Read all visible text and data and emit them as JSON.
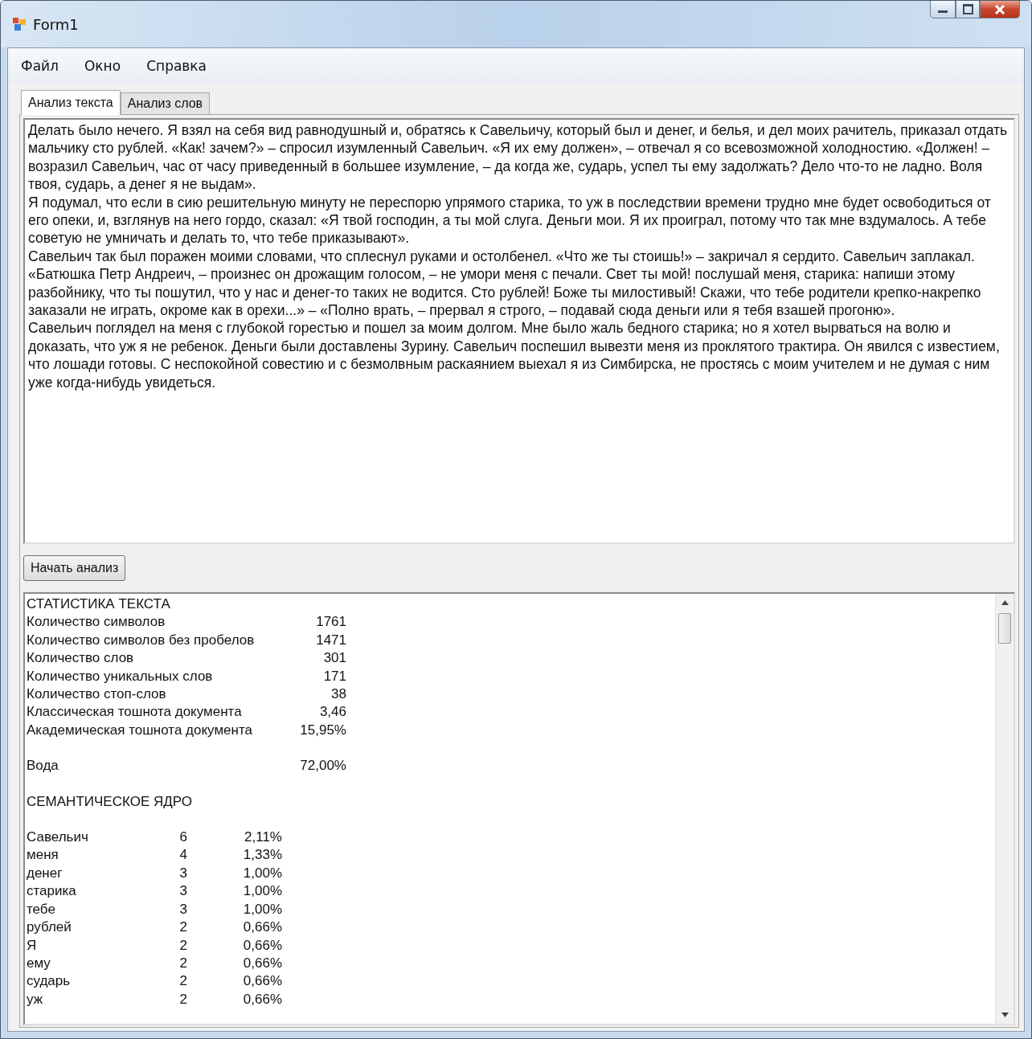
{
  "window": {
    "title": "Form1"
  },
  "menu": [
    "Файл",
    "Окно",
    "Справка"
  ],
  "tabs": [
    {
      "label": "Анализ текста",
      "selected": true
    },
    {
      "label": "Анализ слов",
      "selected": false
    }
  ],
  "text_input": {
    "paragraphs": [
      "Делать было нечего. Я взял на себя вид равнодушный и, обратясь к Савельичу, который был и денег, и белья, и дел моих рачитель, приказал отдать мальчику сто рублей. «Как! зачем?» – спросил изумленный Савельич. «Я их ему должен», – отвечал я со всевозможной холодностию. «Должен! – возразил Савельич, час от часу приведенный в большее изумление, – да когда же, сударь, успел ты ему задолжать? Дело что-то не ладно. Воля твоя, сударь, а денег я не выдам».",
      "Я подумал, что если в сию решительную минуту не переспорю упрямого старика, то уж в последствии времени трудно мне будет освободиться от его опеки, и, взглянув на него гордо, сказал: «Я твой господин, а ты мой слуга. Деньги мои. Я их проиграл, потому что так мне вздумалось. А тебе советую не умничать и делать то, что тебе приказывают».",
      "Савельич так был поражен моими словами, что сплеснул руками и остолбенел. «Что же ты стоишь!» – закричал я сердито. Савельич заплакал. «Батюшка Петр Андреич, – произнес он дрожащим голосом, – не умори меня с печали. Свет ты мой! послушай меня, старика: напиши этому разбойнику, что ты пошутил, что у нас и денег-то таких не водится. Сто рублей! Боже ты милостивый! Скажи, что тебе родители крепко-накрепко заказали не играть, окроме как в орехи...» – «Полно врать, – прервал я строго, – подавай сюда деньги или я тебя взашей прогоню».",
      "Савельич поглядел на меня с глубокой горестью и пошел за моим долгом. Мне было жаль бедного старика; но я хотел вырваться на волю и доказать, что уж я не ребенок. Деньги были доставлены Зурину. Савельич поспешил вывезти меня из проклятого трактира. Он явился с известием, что лошади готовы. С неспокойной совестию и с безмолвным раскаянием выехал я из Симбирска, не простясь с моим учителем и не думая с ним уже когда-нибудь увидеться."
    ]
  },
  "analyze_button": "Начать анализ",
  "results": {
    "heading": "СТАТИСТИКА ТЕКСТА",
    "stats": [
      {
        "label": "Количество символов",
        "value": "1761"
      },
      {
        "label": "Количество символов без пробелов",
        "value": "1471"
      },
      {
        "label": "Количество слов",
        "value": "301"
      },
      {
        "label": "Количество уникальных слов",
        "value": "171"
      },
      {
        "label": "Количество стоп-слов",
        "value": "38"
      },
      {
        "label": "Классическая тошнота документа",
        "value": "3,46"
      },
      {
        "label": "Академическая тошнота документа",
        "value": "15,95%"
      }
    ],
    "water": {
      "label": "Вода",
      "value": "72,00%"
    },
    "semantic_heading": "СЕМАНТИЧЕСКОЕ ЯДРО",
    "semantic_core": [
      {
        "word": "Савельич",
        "count": "6",
        "percent": "2,11%"
      },
      {
        "word": "меня",
        "count": "4",
        "percent": "1,33%"
      },
      {
        "word": "денег",
        "count": "3",
        "percent": "1,00%"
      },
      {
        "word": "старика",
        "count": "3",
        "percent": "1,00%"
      },
      {
        "word": "тебе",
        "count": "3",
        "percent": "1,00%"
      },
      {
        "word": "рублей",
        "count": "2",
        "percent": "0,66%"
      },
      {
        "word": "Я",
        "count": "2",
        "percent": "0,66%"
      },
      {
        "word": "ему",
        "count": "2",
        "percent": "0,66%"
      },
      {
        "word": "сударь",
        "count": "2",
        "percent": "0,66%"
      },
      {
        "word": "уж",
        "count": "2",
        "percent": "0,66%"
      }
    ]
  }
}
